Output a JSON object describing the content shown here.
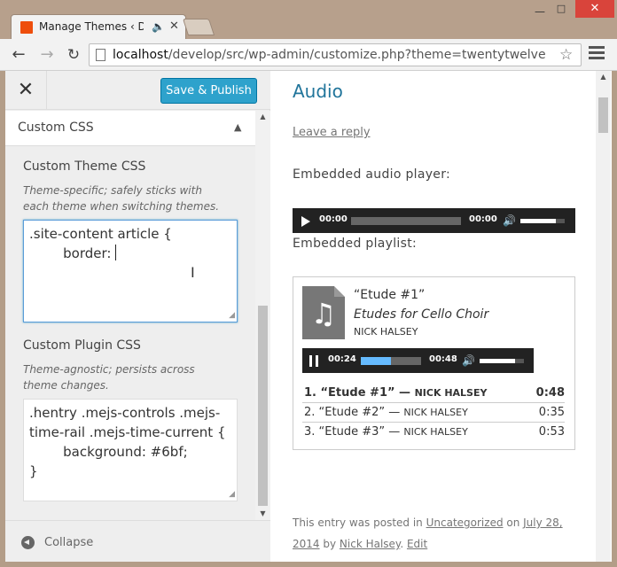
{
  "browser": {
    "tab_title": "Manage Themes ‹ Develop",
    "url_host": "localhost",
    "url_path": "/develop/src/wp-admin/customize.php?theme=twentytwelve"
  },
  "customizer": {
    "publish_label": "Save & Publish",
    "section_title": "Custom CSS",
    "controls": [
      {
        "title": "Custom Theme CSS",
        "description": "Theme-specific; safely sticks with each theme when switching themes.",
        "value": ".site-content article {\n        border: "
      },
      {
        "title": "Custom Plugin CSS",
        "description": "Theme-agnostic; persists across theme changes.",
        "value": ".hentry .mejs-controls .mejs-\ntime-rail .mejs-time-current {\n        background: #6bf;\n}"
      }
    ],
    "collapse_label": "Collapse"
  },
  "preview": {
    "post_title": "Audio",
    "leave_reply": "Leave a reply",
    "embedded_audio_label": "Embedded audio player:",
    "audio_player": {
      "current": "00:00",
      "duration": "00:00",
      "progress": 0,
      "volume": 0.8
    },
    "embedded_playlist_label": "Embedded playlist:",
    "playlist": {
      "now_title": "“Etude #1”",
      "now_album": "Etudes for Cello Choir",
      "now_artist": "NICK HALSEY",
      "player": {
        "current": "00:24",
        "duration": "00:48",
        "progress": 0.5,
        "volume": 0.8
      },
      "tracks": [
        {
          "label": "1. “Etude #1” — ",
          "artist": "NICK HALSEY",
          "length": "0:48"
        },
        {
          "label": "2. “Etude #2” — ",
          "artist": "NICK HALSEY",
          "length": "0:35"
        },
        {
          "label": "3. “Etude #3” — ",
          "artist": "NICK HALSEY",
          "length": "0:53"
        }
      ]
    },
    "footer": {
      "prefix": "This entry was posted in ",
      "category": "Uncategorized",
      "on": " on ",
      "date": "July 28, 2014",
      "by": " by ",
      "author": "Nick Halsey",
      "sep": ". ",
      "edit": "Edit"
    }
  }
}
